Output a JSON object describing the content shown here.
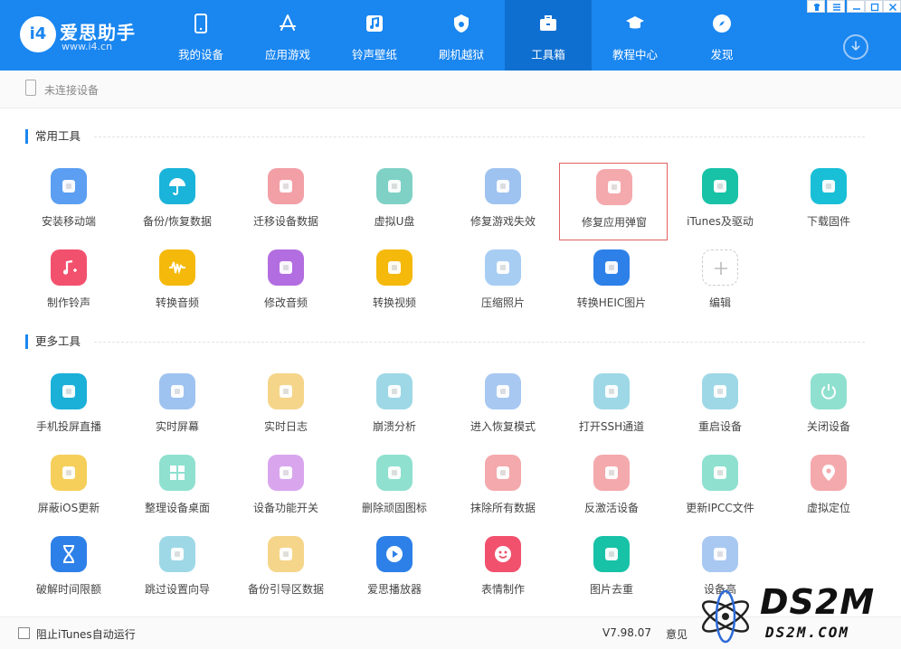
{
  "brand": {
    "name": "爱思助手",
    "url": "www.i4.cn",
    "mark": "i4"
  },
  "nav": [
    {
      "label": "我的设备",
      "icon": "phone-icon"
    },
    {
      "label": "应用游戏",
      "icon": "appstore-icon"
    },
    {
      "label": "铃声壁纸",
      "icon": "music-note-icon"
    },
    {
      "label": "刷机越狱",
      "icon": "shield-icon"
    },
    {
      "label": "工具箱",
      "icon": "toolbox-icon",
      "active": true
    },
    {
      "label": "教程中心",
      "icon": "graduation-cap-icon"
    },
    {
      "label": "发现",
      "icon": "compass-icon"
    }
  ],
  "device": {
    "status": "未连接设备"
  },
  "sections": {
    "common": "常用工具",
    "more": "更多工具"
  },
  "tools_common": [
    {
      "label": "安装移动端",
      "icon": "i4-app-icon",
      "color": "#5b9ef2"
    },
    {
      "label": "备份/恢复数据",
      "icon": "umbrella-icon",
      "color": "#1ab3d9"
    },
    {
      "label": "迁移设备数据",
      "icon": "transfer-icon",
      "color": "#f29fa6"
    },
    {
      "label": "虚拟U盘",
      "icon": "usb-icon",
      "color": "#7fd1c5"
    },
    {
      "label": "修复游戏失效",
      "icon": "gamepad-icon",
      "color": "#9fc3f0"
    },
    {
      "label": "修复应用弹窗",
      "icon": "repair-icon",
      "color": "#f4a9ad",
      "selected": true
    },
    {
      "label": "iTunes及驱动",
      "icon": "itunes-icon",
      "color": "#18c2a7"
    },
    {
      "label": "下载固件",
      "icon": "download-box-icon",
      "color": "#18bfd6"
    },
    {
      "label": "制作铃声",
      "icon": "ringtone-icon",
      "color": "#f2516e"
    },
    {
      "label": "转换音频",
      "icon": "waveform-icon",
      "color": "#f5b90c"
    },
    {
      "label": "修改音频",
      "icon": "audio-edit-icon",
      "color": "#b26de0"
    },
    {
      "label": "转换视频",
      "icon": "video-icon",
      "color": "#f5b90c"
    },
    {
      "label": "压缩照片",
      "icon": "photo-icon",
      "color": "#a8cdf3"
    },
    {
      "label": "转换HEIC图片",
      "icon": "heic-icon",
      "color": "#2d80e8"
    },
    {
      "label": "编辑",
      "icon": "plus-icon",
      "color": "#ffffff"
    }
  ],
  "tools_more": [
    {
      "label": "手机投屏直播",
      "icon": "screen-cast-icon",
      "color": "#1ab0d8"
    },
    {
      "label": "实时屏幕",
      "icon": "live-screen-icon",
      "color": "#9fc3f0"
    },
    {
      "label": "实时日志",
      "icon": "log-icon",
      "color": "#f5d58a"
    },
    {
      "label": "崩溃分析",
      "icon": "crash-icon",
      "color": "#9ed8e6"
    },
    {
      "label": "进入恢复模式",
      "icon": "recovery-icon",
      "color": "#a8c8f2"
    },
    {
      "label": "打开SSH通道",
      "icon": "terminal-icon",
      "color": "#9ed8e6"
    },
    {
      "label": "重启设备",
      "icon": "restart-icon",
      "color": "#9ed8e6"
    },
    {
      "label": "关闭设备",
      "icon": "power-icon",
      "color": "#8fe0cf"
    },
    {
      "label": "屏蔽iOS更新",
      "icon": "gear-block-icon",
      "color": "#f5cf5a"
    },
    {
      "label": "整理设备桌面",
      "icon": "grid-icon",
      "color": "#8fe0cf"
    },
    {
      "label": "设备功能开关",
      "icon": "toggle-icon",
      "color": "#d9a6ee"
    },
    {
      "label": "删除顽固图标",
      "icon": "pie-icon",
      "color": "#8fe0cf"
    },
    {
      "label": "抹除所有数据",
      "icon": "eraser-icon",
      "color": "#f4a9ad"
    },
    {
      "label": "反激活设备",
      "icon": "deactivate-icon",
      "color": "#f4a9ad"
    },
    {
      "label": "更新IPCC文件",
      "icon": "ipcc-icon",
      "color": "#8fe0cf"
    },
    {
      "label": "虚拟定位",
      "icon": "location-icon",
      "color": "#f4a9ad"
    },
    {
      "label": "破解时间限额",
      "icon": "hourglass-icon",
      "color": "#2d80e8"
    },
    {
      "label": "跳过设置向导",
      "icon": "skip-icon",
      "color": "#9ed8e6"
    },
    {
      "label": "备份引导区数据",
      "icon": "backup-boot-icon",
      "color": "#f5d58a"
    },
    {
      "label": "爱思播放器",
      "icon": "play-icon",
      "color": "#2d80e8"
    },
    {
      "label": "表情制作",
      "icon": "emoji-icon",
      "color": "#f2516e"
    },
    {
      "label": "图片去重",
      "icon": "dedupe-photo-icon",
      "color": "#18c2a7"
    },
    {
      "label": "设备高",
      "icon": "broom-icon",
      "color": "#a8c8f2"
    }
  ],
  "status": {
    "itunes_checkbox": "阻止iTunes自动运行",
    "version": "V7.98.07",
    "feedback": "意见"
  },
  "watermark": {
    "big": "DS2M",
    "small": "DS2M.COM"
  }
}
